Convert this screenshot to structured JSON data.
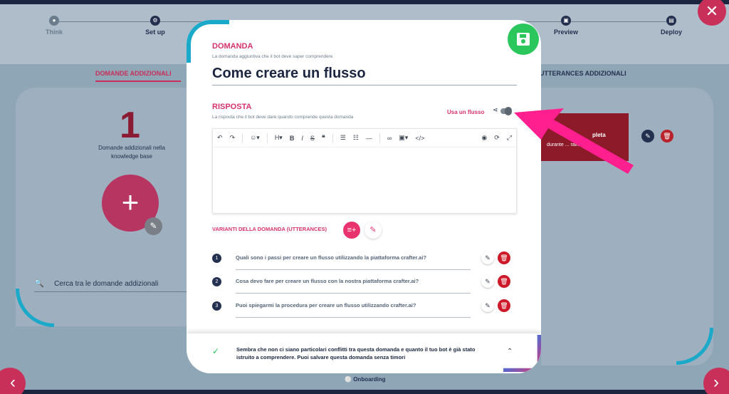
{
  "stepper": {
    "steps": [
      {
        "label": "Think",
        "active": false
      },
      {
        "label": "Set up",
        "active": true
      },
      {
        "label": "Preview",
        "active": true
      },
      {
        "label": "Deploy",
        "active": true
      }
    ]
  },
  "tabs": {
    "left": "DOMANDE ADDIZIONALI",
    "right": "UTTERANCES ADDIZIONALI"
  },
  "left_panel": {
    "count": "1",
    "count_label": "Domande addizionali nella knowledge base",
    "search_placeholder": "Cerca tra le domande addizionali"
  },
  "right_panel": {
    "card_title": "pleta",
    "card_text": "durante ... raining."
  },
  "modal": {
    "domanda_title": "DOMANDA",
    "domanda_sub": "La domanda aggiuntiva che il bot deve saper comprendere",
    "question": "Come creare un flusso",
    "risposta_title": "RISPOSTA",
    "risposta_sub": "La risposta che il bot deve dare quando comprende questa domanda",
    "flow_toggle_label": "Usa un flusso",
    "utterances_title": "VARIANTI DELLA DOMANDA (UTTERANCES)",
    "utterances": [
      {
        "num": "1",
        "text": "Quali sono i passi per creare un flusso utilizzando la piattaforma crafter.ai?"
      },
      {
        "num": "2",
        "text": "Cosa devo fare per creare un flusso con la nostra piattaforma crafter.ai?"
      },
      {
        "num": "3",
        "text": "Puoi spiegarmi la procedura per creare un flusso utilizzando crafter.ai?"
      }
    ],
    "footer_message": "Sembra che non ci siano particolari conflitti tra questa domanda e quanto il tuo bot è già stato istruito a comprendere. Puoi salvare questa domanda senza timori"
  },
  "bottom": {
    "onboarding": "Onboarding"
  },
  "colors": {
    "accent": "#d6336c",
    "navy": "#1b2540",
    "cyan": "#1aa9c9",
    "save_green": "#2bc65c",
    "arrow_pink": "#ff1f8e"
  }
}
